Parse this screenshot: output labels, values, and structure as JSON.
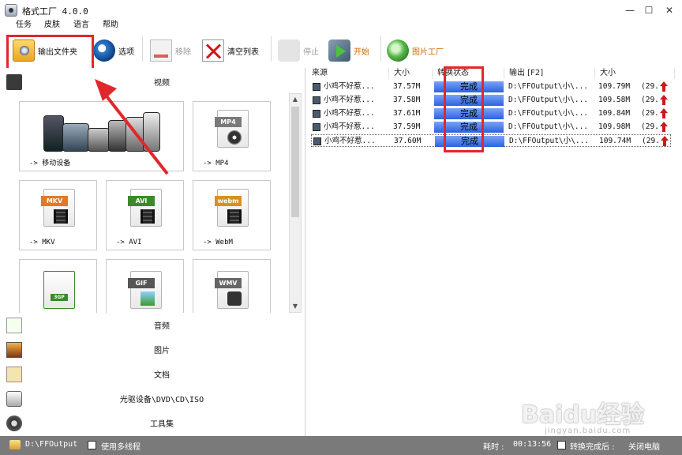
{
  "window": {
    "title": "格式工厂 4.0.0",
    "minimize": "—",
    "maximize": "☐",
    "close": "✕"
  },
  "menu": [
    "任务",
    "皮肤",
    "语言",
    "帮助"
  ],
  "toolbar": {
    "output_folder": "输出文件夹",
    "options": "选项",
    "remove": "移除",
    "clear_list": "清空列表",
    "stop": "停止",
    "start": "开始",
    "picture_tool": "图片工厂"
  },
  "categories": {
    "video": "视频",
    "audio": "音频",
    "picture": "图片",
    "document": "文档",
    "rom": "光驱设备\\DVD\\CD\\ISO",
    "tools": "工具集"
  },
  "formats": {
    "mobile": "-> 移动设备",
    "mp4": "-> MP4",
    "mkv": "-> MKV",
    "avi": "-> AVI",
    "webm": "-> WebM",
    "tag_mp4": "MP4",
    "tag_mkv": "MKV",
    "tag_avi": "AVI",
    "tag_webm": "webm",
    "tag_3gp": "3GP",
    "tag_gif": "GIF",
    "tag_wmv": "WMV"
  },
  "table": {
    "headers": [
      "来源",
      "大小",
      "转换状态",
      "输出 [F2]",
      "大小"
    ],
    "rows": [
      {
        "source": "小鸡不好惹...",
        "size": "37.57M",
        "status": "完成",
        "output": "D:\\FFOutput\\小\\...",
        "out_size": "109.79M",
        "ratio": "(29..."
      },
      {
        "source": "小鸡不好惹...",
        "size": "37.58M",
        "status": "完成",
        "output": "D:\\FFOutput\\小\\...",
        "out_size": "109.58M",
        "ratio": "(29..."
      },
      {
        "source": "小鸡不好惹...",
        "size": "37.61M",
        "status": "完成",
        "output": "D:\\FFOutput\\小\\...",
        "out_size": "109.84M",
        "ratio": "(29..."
      },
      {
        "source": "小鸡不好惹...",
        "size": "37.59M",
        "status": "完成",
        "output": "D:\\FFOutput\\小\\...",
        "out_size": "109.98M",
        "ratio": "(29..."
      },
      {
        "source": "小鸡不好惹...",
        "size": "37.60M",
        "status": "完成",
        "output": "D:\\FFOutput\\小\\...",
        "out_size": "109.74M",
        "ratio": "(29..."
      }
    ]
  },
  "statusbar": {
    "output_path": "D:\\FFOutput",
    "multithread": "使用多线程",
    "elapsed_label": "耗时 :",
    "elapsed": "00:13:56",
    "after_done": "转换完成后 :",
    "shutdown": "关闭电脑"
  },
  "watermark": {
    "brand": "Baidu经验",
    "url": "jingyan.baidu.com"
  },
  "colors": {
    "status_complete": "#2c62e0",
    "highlight": "#e0282c",
    "statusbar_bg": "#7a7a7a"
  }
}
